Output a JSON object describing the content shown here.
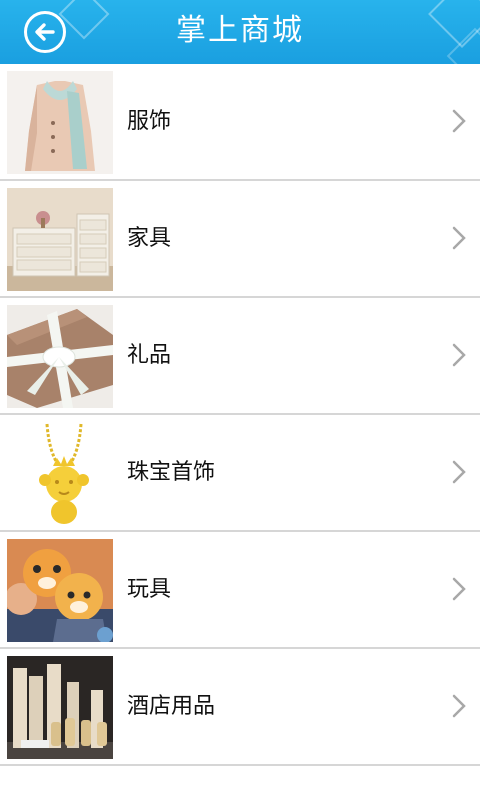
{
  "header": {
    "title": "掌上商城",
    "color": "#1a9fe0"
  },
  "categories": [
    {
      "label": "服饰",
      "image": "coat-with-scarf"
    },
    {
      "label": "家具",
      "image": "white-dresser"
    },
    {
      "label": "礼品",
      "image": "gift-with-ribbon"
    },
    {
      "label": "珠宝首饰",
      "image": "gold-pendant-necklace"
    },
    {
      "label": "玩具",
      "image": "plush-tiger-toys"
    },
    {
      "label": "酒店用品",
      "image": "hotel-toiletries"
    }
  ]
}
